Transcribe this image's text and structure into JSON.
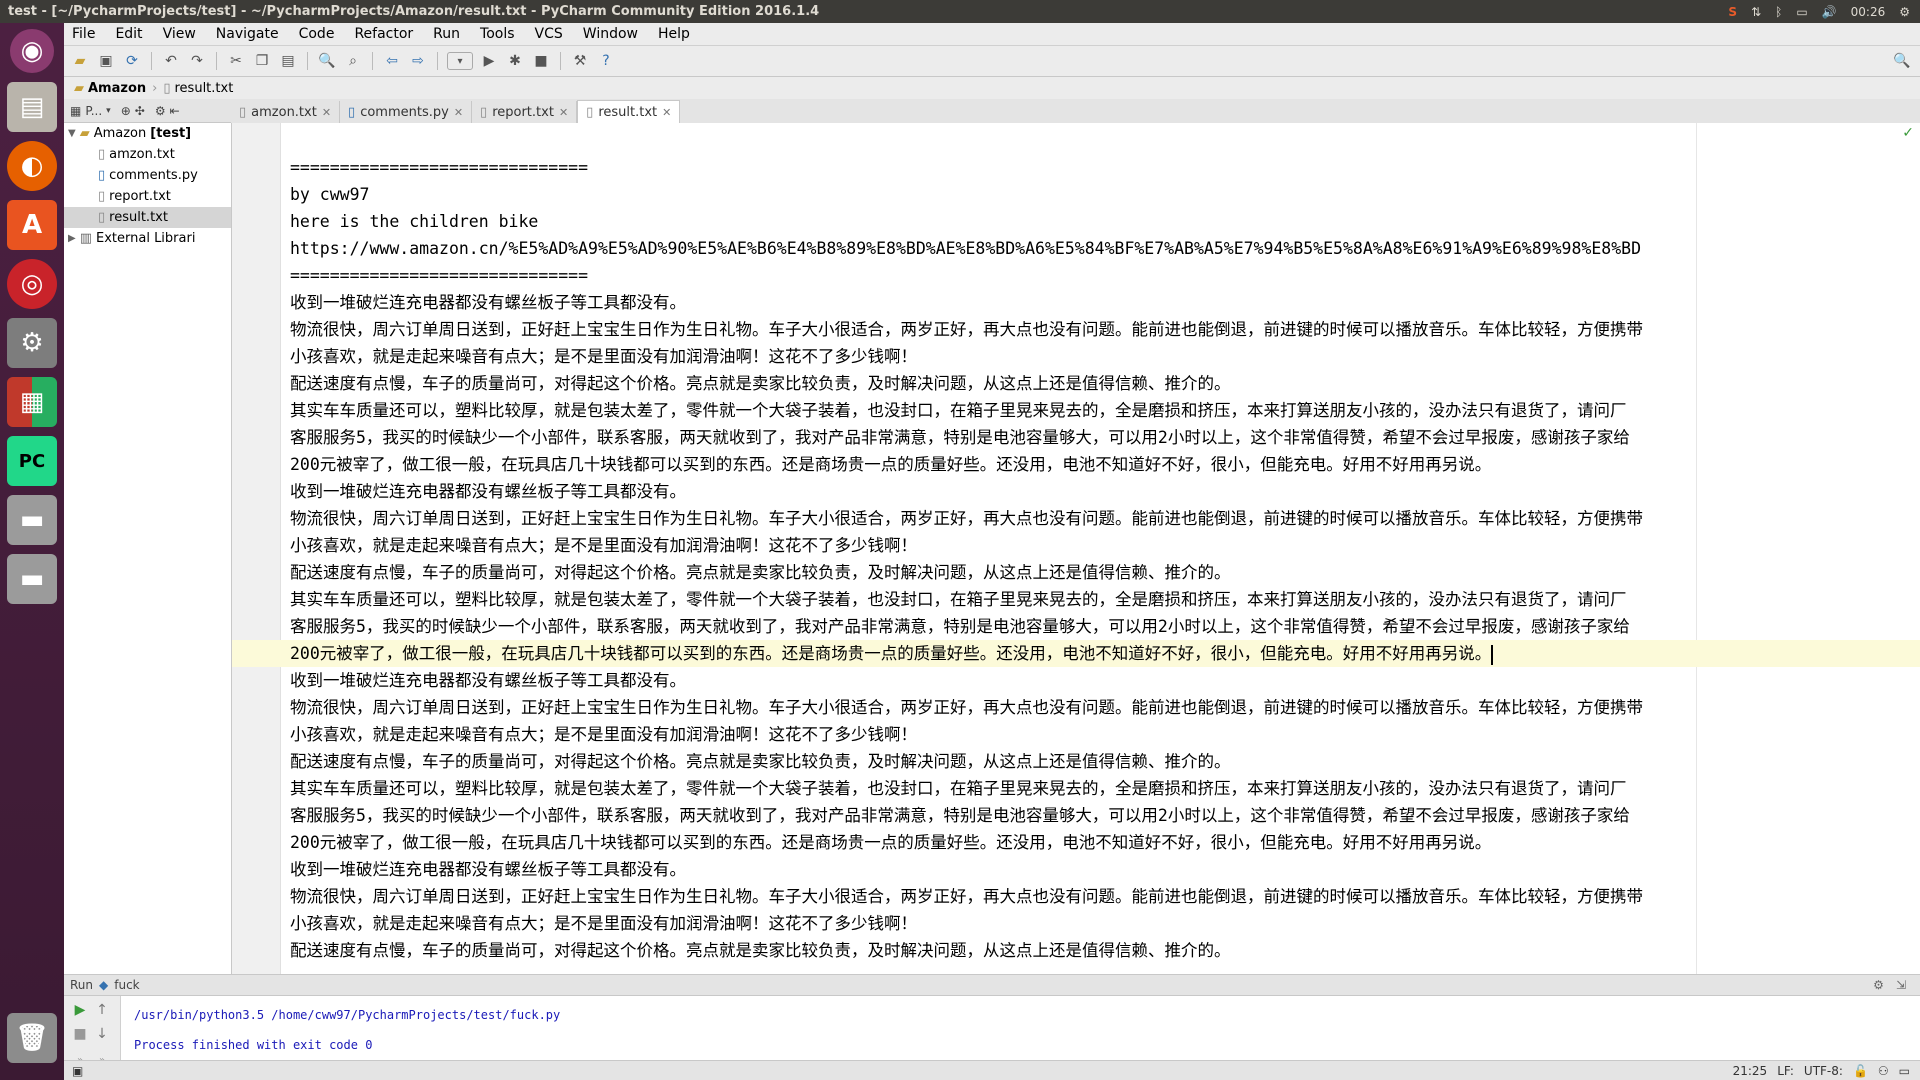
{
  "window_title": "test - [~/PycharmProjects/test] - ~/PycharmProjects/Amazon/result.txt - PyCharm Community Edition 2016.1.4",
  "system": {
    "clock": "00:26"
  },
  "menu": [
    "File",
    "Edit",
    "View",
    "Navigate",
    "Code",
    "Refactor",
    "Run",
    "Tools",
    "VCS",
    "Window",
    "Help"
  ],
  "breadcrumb": {
    "project": "Amazon",
    "file": "result.txt"
  },
  "project_panel": {
    "header": "P...",
    "root": "Amazon",
    "root_tag": "[test]",
    "files": [
      "amzon.txt",
      "comments.py",
      "report.txt",
      "result.txt"
    ],
    "external": "External Librari"
  },
  "tabs": [
    "amzon.txt",
    "comments.py",
    "report.txt",
    "result.txt"
  ],
  "editor": {
    "lines": [
      "==============================",
      "by cww97",
      "here is the children bike",
      "https://www.amazon.cn/%E5%AD%A9%E5%AD%90%E5%AE%B6%E4%B8%89%E8%BD%AE%E8%BD%A6%E5%84%BF%E7%AB%A5%E7%94%B5%E5%8A%A8%E6%91%A9%E6%89%98%E8%BD",
      "==============================",
      "收到一堆破烂连充电器都没有螺丝板子等工具都没有。",
      "物流很快，周六订单周日送到，正好赶上宝宝生日作为生日礼物。车子大小很适合，两岁正好，再大点也没有问题。能前进也能倒退，前进键的时候可以播放音乐。车体比较轻，方便携带",
      "小孩喜欢，就是走起来噪音有点大；是不是里面没有加润滑油啊！这花不了多少钱啊！",
      "配送速度有点慢，车子的质量尚可，对得起这个价格。亮点就是卖家比较负责，及时解决问题，从这点上还是值得信赖、推介的。",
      "其实车车质量还可以，塑料比较厚，就是包装太差了，零件就一个大袋子装着，也没封口，在箱子里晃来晃去的，全是磨损和挤压，本来打算送朋友小孩的，没办法只有退货了，请问厂",
      "客服服务5，我买的时候缺少一个小部件，联系客服，两天就收到了，我对产品非常满意，特别是电池容量够大，可以用2小时以上，这个非常值得赞，希望不会过早报废，感谢孩子家给",
      "200元被宰了，做工很一般，在玩具店几十块钱都可以买到的东西。还是商场贵一点的质量好些。还没用，电池不知道好不好，很小，但能充电。好用不好用再另说。",
      "收到一堆破烂连充电器都没有螺丝板子等工具都没有。",
      "物流很快，周六订单周日送到，正好赶上宝宝生日作为生日礼物。车子大小很适合，两岁正好，再大点也没有问题。能前进也能倒退，前进键的时候可以播放音乐。车体比较轻，方便携带",
      "小孩喜欢，就是走起来噪音有点大；是不是里面没有加润滑油啊！这花不了多少钱啊！",
      "配送速度有点慢，车子的质量尚可，对得起这个价格。亮点就是卖家比较负责，及时解决问题，从这点上还是值得信赖、推介的。",
      "其实车车质量还可以，塑料比较厚，就是包装太差了，零件就一个大袋子装着，也没封口，在箱子里晃来晃去的，全是磨损和挤压，本来打算送朋友小孩的，没办法只有退货了，请问厂",
      "客服服务5，我买的时候缺少一个小部件，联系客服，两天就收到了，我对产品非常满意，特别是电池容量够大，可以用2小时以上，这个非常值得赞，希望不会过早报废，感谢孩子家给",
      "200元被宰了，做工很一般，在玩具店几十块钱都可以买到的东西。还是商场贵一点的质量好些。还没用，电池不知道好不好，很小，但能充电。好用不好用再另说。",
      "收到一堆破烂连充电器都没有螺丝板子等工具都没有。",
      "物流很快，周六订单周日送到，正好赶上宝宝生日作为生日礼物。车子大小很适合，两岁正好，再大点也没有问题。能前进也能倒退，前进键的时候可以播放音乐。车体比较轻，方便携带",
      "小孩喜欢，就是走起来噪音有点大；是不是里面没有加润滑油啊！这花不了多少钱啊！",
      "配送速度有点慢，车子的质量尚可，对得起这个价格。亮点就是卖家比较负责，及时解决问题，从这点上还是值得信赖、推介的。",
      "其实车车质量还可以，塑料比较厚，就是包装太差了，零件就一个大袋子装着，也没封口，在箱子里晃来晃去的，全是磨损和挤压，本来打算送朋友小孩的，没办法只有退货了，请问厂",
      "客服服务5，我买的时候缺少一个小部件，联系客服，两天就收到了，我对产品非常满意，特别是电池容量够大，可以用2小时以上，这个非常值得赞，希望不会过早报废，感谢孩子家给",
      "200元被宰了，做工很一般，在玩具店几十块钱都可以买到的东西。还是商场贵一点的质量好些。还没用，电池不知道好不好，很小，但能充电。好用不好用再另说。",
      "收到一堆破烂连充电器都没有螺丝板子等工具都没有。",
      "物流很快，周六订单周日送到，正好赶上宝宝生日作为生日礼物。车子大小很适合，两岁正好，再大点也没有问题。能前进也能倒退，前进键的时候可以播放音乐。车体比较轻，方便携带",
      "小孩喜欢，就是走起来噪音有点大；是不是里面没有加润滑油啊！这花不了多少钱啊！",
      "配送速度有点慢，车子的质量尚可，对得起这个价格。亮点就是卖家比较负责，及时解决问题，从这点上还是值得信赖、推介的。"
    ],
    "current_line_index": 18
  },
  "run": {
    "label": "Run",
    "config": "fuck",
    "command": "/usr/bin/python3.5 /home/cww97/PycharmProjects/test/fuck.py",
    "result": "Process finished with exit code 0"
  },
  "status": {
    "position": "21:25",
    "line_sep": "LF:",
    "encoding": "UTF-8:"
  }
}
